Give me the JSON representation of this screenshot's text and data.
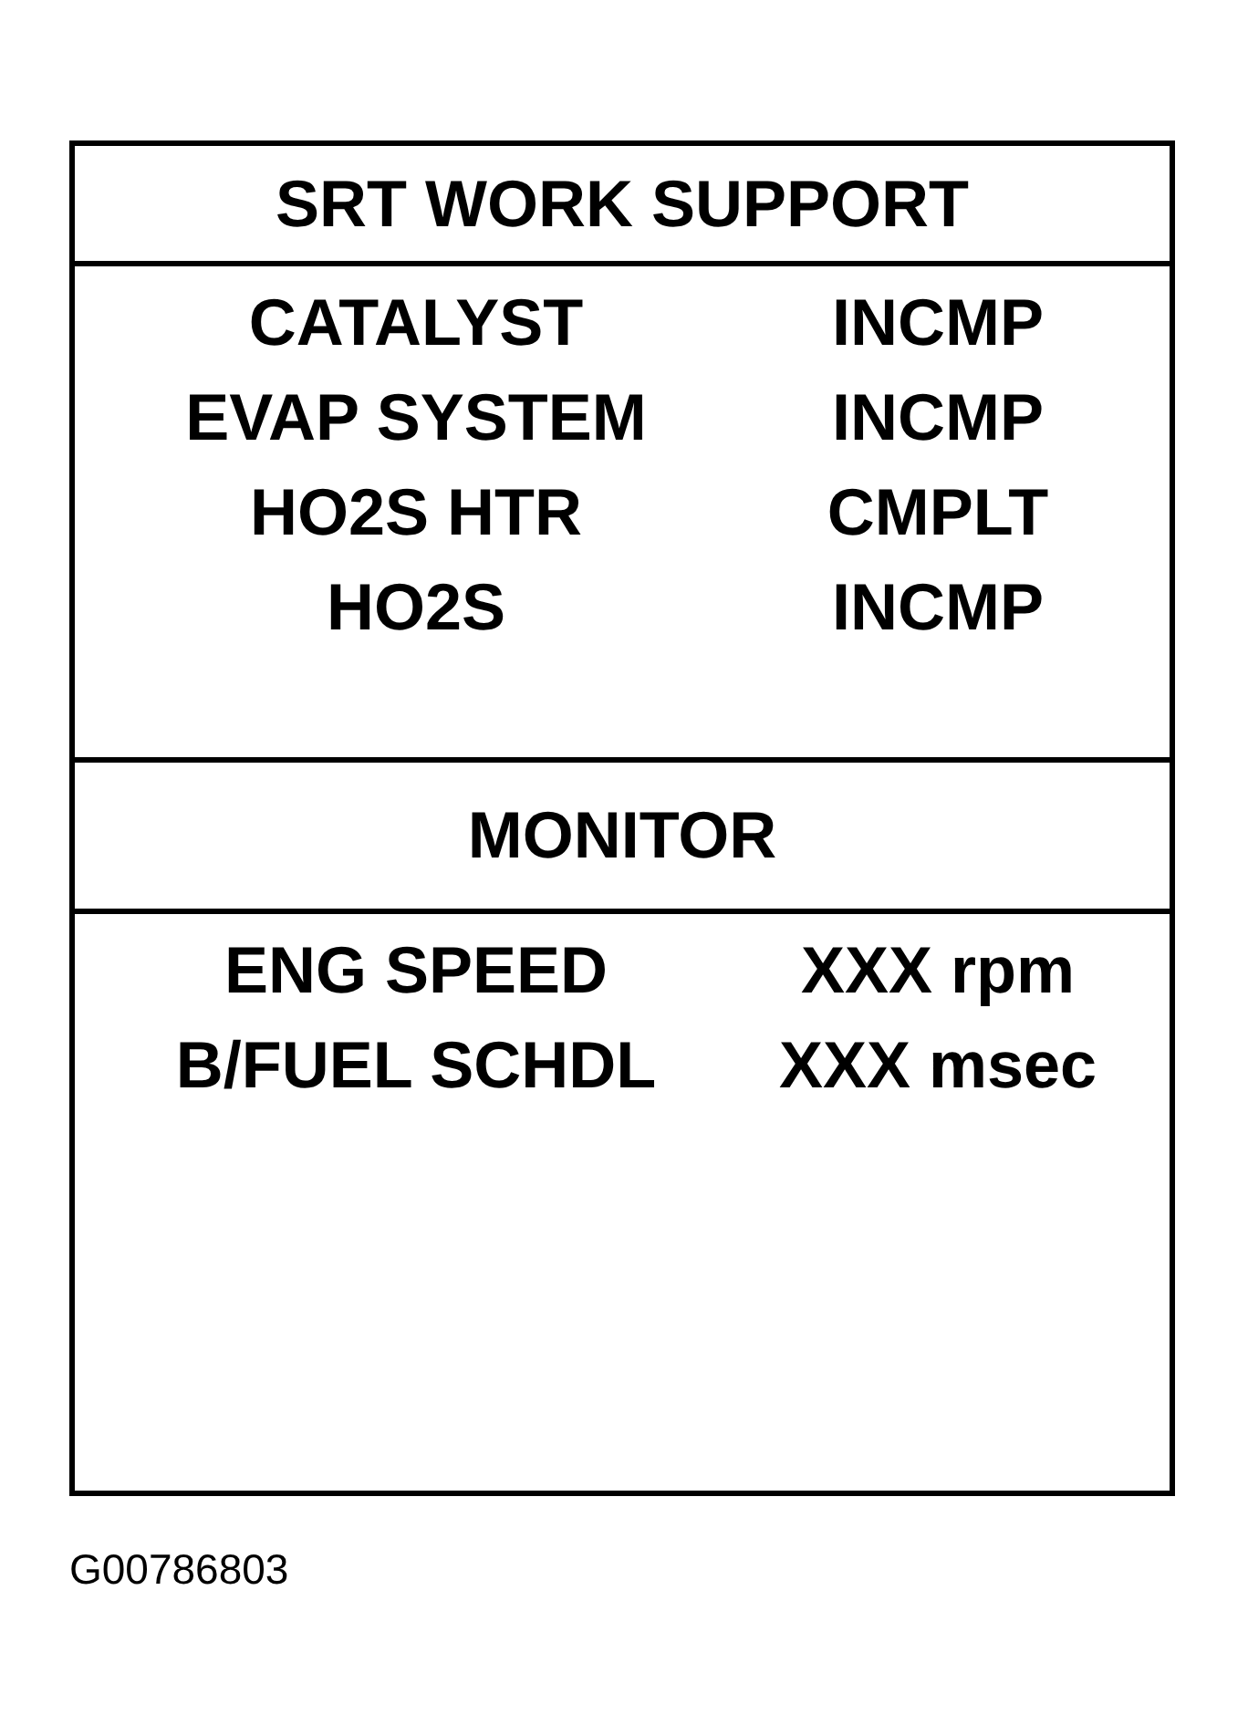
{
  "panel": {
    "sections": [
      {
        "title": "SRT WORK SUPPORT",
        "rows": [
          {
            "label": "CATALYST",
            "value": "INCMP"
          },
          {
            "label": "EVAP SYSTEM",
            "value": "INCMP"
          },
          {
            "label": "HO2S HTR",
            "value": "CMPLT"
          },
          {
            "label": "HO2S",
            "value": "INCMP"
          }
        ]
      },
      {
        "title": "MONITOR",
        "rows": [
          {
            "label": "ENG SPEED",
            "value": "XXX rpm"
          },
          {
            "label": "B/FUEL SCHDL",
            "value": "XXX msec"
          }
        ]
      }
    ]
  },
  "figure_code": "G00786803"
}
